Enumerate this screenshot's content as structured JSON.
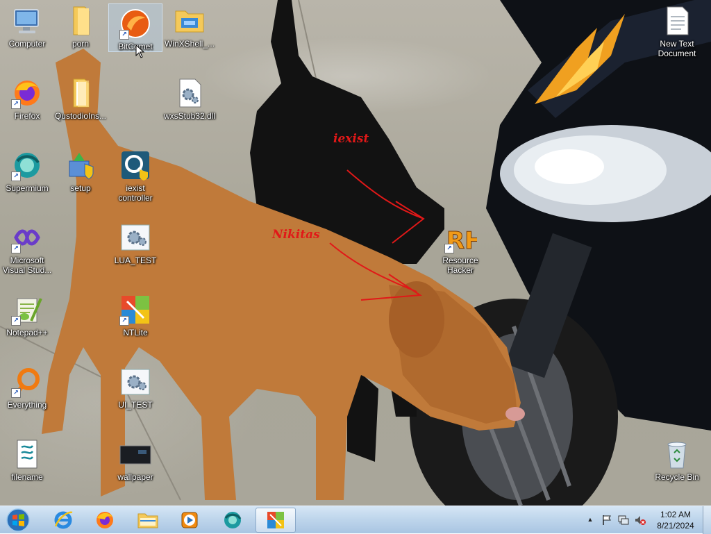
{
  "desktop": {
    "icons": [
      {
        "id": "computer",
        "label": "Computer"
      },
      {
        "id": "porn",
        "label": "porn"
      },
      {
        "id": "bitcomet",
        "label": "BitComet"
      },
      {
        "id": "winxshell",
        "label": "WinXShell_..."
      },
      {
        "id": "new-text-document",
        "label": "New Text Document"
      },
      {
        "id": "firefox",
        "label": "Firefox"
      },
      {
        "id": "qustodio",
        "label": "QustodioIns..."
      },
      {
        "id": "wxsstub32",
        "label": "wxsStub32.dll"
      },
      {
        "id": "supermium",
        "label": "Supermium"
      },
      {
        "id": "setup",
        "label": "setup"
      },
      {
        "id": "iexist-controller",
        "label": "iexist controller"
      },
      {
        "id": "visual-studio",
        "label": "Microsoft Visual Stud..."
      },
      {
        "id": "lua-test",
        "label": "LUA_TEST"
      },
      {
        "id": "resource-hacker",
        "label": "Resource Hacker"
      },
      {
        "id": "notepadpp",
        "label": "Notepad++"
      },
      {
        "id": "ntlite",
        "label": "NTLite"
      },
      {
        "id": "everything",
        "label": "Everything"
      },
      {
        "id": "ui-test",
        "label": "UI_TEST"
      },
      {
        "id": "filename",
        "label": "filename"
      },
      {
        "id": "wallpaper",
        "label": "wallpaper"
      },
      {
        "id": "recycle-bin",
        "label": "Recycle Bin"
      }
    ],
    "selected_icon": "BitComet"
  },
  "wallpaper_annotations": {
    "black_dog_label": "iexist",
    "brown_dog_label": "Nikitas",
    "annotation_color": "#e11818"
  },
  "taskbar": {
    "start_icon": "windows-orb-icon",
    "pinned": [
      {
        "name": "internet-explorer-icon"
      },
      {
        "name": "firefox-icon"
      },
      {
        "name": "explorer-folder-icon"
      },
      {
        "name": "media-player-icon"
      },
      {
        "name": "supermium-icon"
      },
      {
        "name": "ntlite-icon",
        "active": true
      }
    ],
    "tray_icons": [
      "show-hidden-icons-chevron",
      "action-center-flag-icon",
      "network-icon",
      "volume-muted-icon"
    ],
    "clock": {
      "time": "1:02 AM",
      "date": "8/21/2024"
    }
  },
  "colors": {
    "taskbar_top": "#d6e6f5",
    "taskbar_bottom": "#a9c5e2",
    "label_text": "#ffffff",
    "selection": "#b4d2f0"
  }
}
